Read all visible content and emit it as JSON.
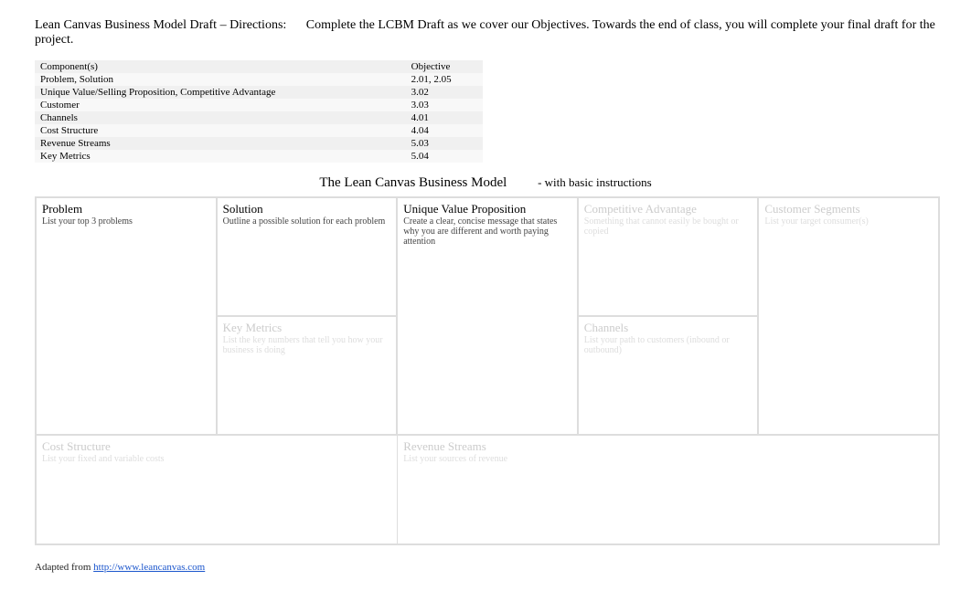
{
  "header": {
    "title": "Lean Canvas Business Model Draft – Directions:",
    "directions": "Complete the LCBM Draft as we cover our Objectives. Towards the end of class, you will complete your final draft for the project."
  },
  "objectives_table": {
    "col1": "Component(s)",
    "col2": "Objective",
    "rows": [
      {
        "component": "Problem, Solution",
        "objective": "2.01, 2.05"
      },
      {
        "component": "Unique Value/Selling Proposition, Competitive Advantage",
        "objective": "3.02"
      },
      {
        "component": "Customer",
        "objective": "3.03"
      },
      {
        "component": "Channels",
        "objective": "4.01"
      },
      {
        "component": "Cost Structure",
        "objective": "4.04"
      },
      {
        "component": "Revenue Streams",
        "objective": "5.03"
      },
      {
        "component": "Key Metrics",
        "objective": "5.04"
      }
    ]
  },
  "canvas_title": {
    "main": "The Lean Canvas Business Model",
    "sub": "- with basic instructions"
  },
  "cells": {
    "problem": {
      "title": "Problem",
      "desc": "List your top 3 problems"
    },
    "solution": {
      "title": "Solution",
      "desc": "Outline a possible solution for each problem"
    },
    "uvp": {
      "title": "Unique Value Proposition",
      "desc": "Create a clear, concise message that states why you are different and worth paying attention"
    },
    "advantage": {
      "title": "Competitive Advantage",
      "desc": "Something that cannot easily be bought or copied"
    },
    "segments": {
      "title": "Customer Segments",
      "desc": "List your target consumer(s)"
    },
    "metrics": {
      "title": "Key Metrics",
      "desc": "List the key numbers that tell you how your business is doing"
    },
    "channels": {
      "title": "Channels",
      "desc": "List your path to customers (inbound or outbound)"
    },
    "cost": {
      "title": "Cost Structure",
      "desc": "List your fixed and variable costs"
    },
    "revenue": {
      "title": "Revenue Streams",
      "desc": "List your sources of revenue"
    }
  },
  "adapted": {
    "prefix": "Adapted from ",
    "link_text": "http://www.leancanvas.com",
    "link_href": "http://www.leancanvas.com"
  }
}
